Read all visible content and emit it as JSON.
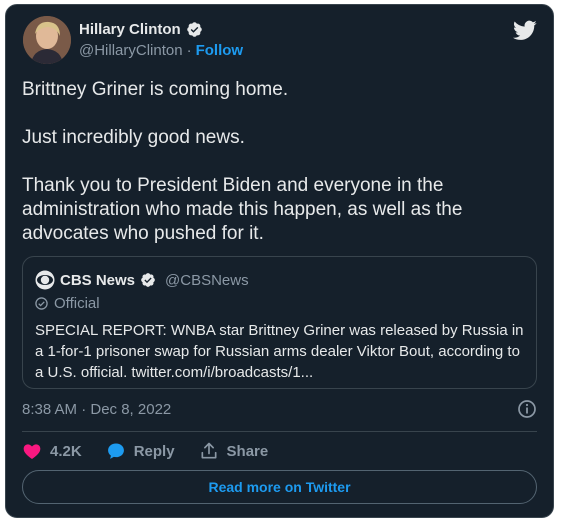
{
  "tweet": {
    "author_name": "Hillary Clinton",
    "author_handle": "@HillaryClinton",
    "separator": "·",
    "follow_label": "Follow",
    "text": "Brittney Griner is coming home.\n\nJust incredibly good news.\n\nThank you to President Biden and everyone in the administration who made this happen, as well as the advocates who pushed for it.",
    "timestamp": "8:38 AM · Dec 8, 2022"
  },
  "quoted": {
    "author_name": "CBS News",
    "author_handle": "@CBSNews",
    "badge_label": "Official",
    "text": "SPECIAL REPORT: WNBA star Brittney Griner was released by Russia in a 1-for-1 prisoner swap for Russian arms dealer Viktor Bout, according to a U.S. official. twitter.com/i/broadcasts/1..."
  },
  "actions": {
    "like_count": "4.2K",
    "reply_label": "Reply",
    "share_label": "Share"
  },
  "footer": {
    "read_more_label": "Read more on Twitter"
  },
  "colors": {
    "background": "#15202b",
    "accent": "#1d9bf0",
    "like": "#f91880",
    "muted": "#8b98a5"
  },
  "icons": [
    "verified-badge-icon",
    "twitter-bird-icon",
    "cbs-eye-icon",
    "official-check-icon",
    "info-icon",
    "heart-icon",
    "reply-bubble-icon",
    "share-icon"
  ]
}
